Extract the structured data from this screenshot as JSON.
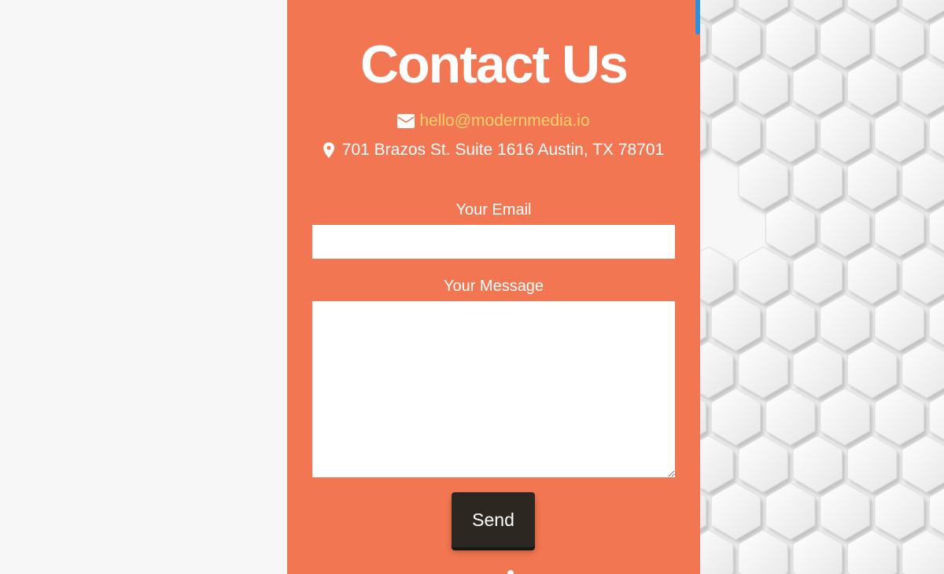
{
  "contact": {
    "title": "Contact Us",
    "email": "hello@modernmedia.io",
    "address": "701 Brazos St. Suite 1616 Austin, TX 78701"
  },
  "form": {
    "email_label": "Your Email",
    "email_value": "",
    "message_label": "Your Message",
    "message_value": "",
    "send_label": "Send"
  },
  "icons": {
    "email": "envelope-icon",
    "address": "map-marker-icon"
  },
  "colors": {
    "panel": "#f27651",
    "email_link": "#ffd36e",
    "button": "#2c2721",
    "page_background": "#f7f7f7",
    "scroll_accent": "#2d8fd8"
  }
}
